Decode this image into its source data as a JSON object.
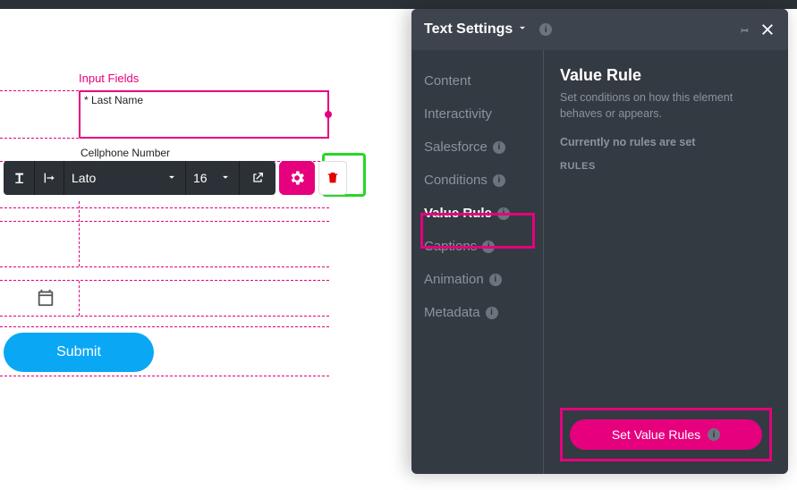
{
  "canvas": {
    "fields_header": "Input Fields",
    "field_last_name_label": "* Last Name",
    "field_cell_label": "Cellphone Number",
    "submit_label": "Submit"
  },
  "toolbar": {
    "font": "Lato",
    "size": "16"
  },
  "panel": {
    "title": "Text Settings",
    "nav": {
      "content": "Content",
      "interactivity": "Interactivity",
      "salesforce": "Salesforce",
      "conditions": "Conditions",
      "value_rule": "Value Rule",
      "captions": "Captions",
      "animation": "Animation",
      "metadata": "Metadata"
    },
    "main": {
      "title": "Value Rule",
      "desc": "Set conditions on how this element behaves or appears.",
      "status": "Currently no rules are set",
      "rules_label": "RULES",
      "button": "Set Value Rules"
    }
  }
}
